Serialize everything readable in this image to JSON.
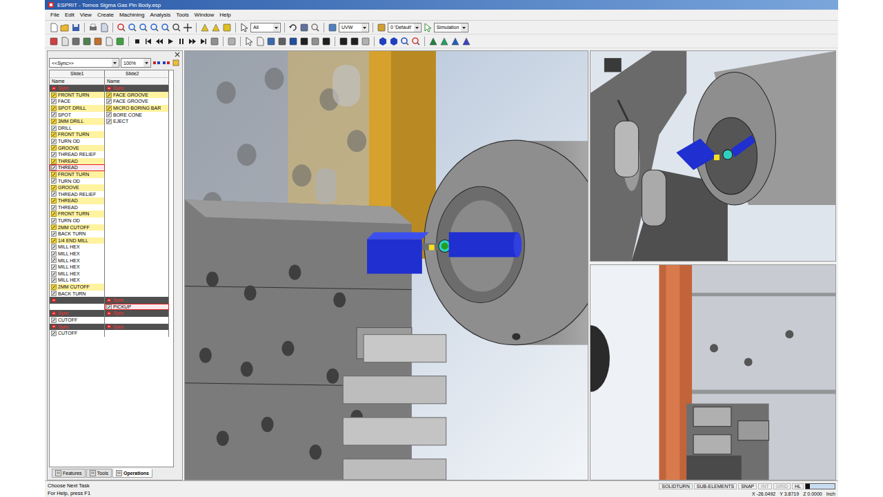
{
  "window": {
    "title": "ESPRIT - Tornos Sigma Gas Pin Body.esp"
  },
  "menu": [
    "File",
    "Edit",
    "View",
    "Create",
    "Machining",
    "Analysis",
    "Tools",
    "Window",
    "Help"
  ],
  "toolbar": {
    "combos": [
      "All",
      "UVW",
      "0 'Default'",
      "Simulation"
    ]
  },
  "operations_panel": {
    "sync_filter": "<<Sync>>",
    "zoom": "100%",
    "columns": [
      "Slide1",
      "Slide2"
    ],
    "subheaders": [
      "Name",
      "Name"
    ],
    "rows": [
      {
        "cells": [
          {
            "text": "Sync",
            "kind": "sync",
            "highlighted": false,
            "selected": false
          },
          {
            "text": "Sync",
            "kind": "sync",
            "highlighted": false,
            "selected": false
          }
        ]
      },
      {
        "cells": [
          {
            "text": "FRONT TURN",
            "kind": "op",
            "highlighted": true,
            "selected": false
          },
          {
            "text": "FACE GROOVE",
            "kind": "op",
            "highlighted": true,
            "selected": false
          }
        ]
      },
      {
        "cells": [
          {
            "text": "FACE",
            "kind": "op",
            "highlighted": false,
            "selected": false
          },
          {
            "text": "FACE GROOVE",
            "kind": "op",
            "highlighted": false,
            "selected": false
          }
        ]
      },
      {
        "cells": [
          {
            "text": "SPOT DRILL",
            "kind": "op",
            "highlighted": true,
            "selected": false
          },
          {
            "text": "MICRO BORING BAR",
            "kind": "op",
            "highlighted": true,
            "selected": false
          }
        ]
      },
      {
        "cells": [
          {
            "text": "SPOT",
            "kind": "op",
            "highlighted": false,
            "selected": false
          },
          {
            "text": "BORE CONE",
            "kind": "op",
            "highlighted": false,
            "selected": false
          }
        ]
      },
      {
        "cells": [
          {
            "text": "3MM DRILL",
            "kind": "op",
            "highlighted": true,
            "selected": false
          },
          {
            "text": "EJECT",
            "kind": "op",
            "highlighted": false,
            "selected": false
          }
        ]
      },
      {
        "cells": [
          {
            "text": "DRILL",
            "kind": "op",
            "highlighted": false,
            "selected": false
          },
          {
            "text": "",
            "kind": "empty",
            "highlighted": false,
            "selected": false
          }
        ]
      },
      {
        "cells": [
          {
            "text": "FRONT TURN",
            "kind": "op",
            "highlighted": true,
            "selected": false
          },
          {
            "text": "",
            "kind": "empty",
            "highlighted": false,
            "selected": false
          }
        ]
      },
      {
        "cells": [
          {
            "text": "TURN OD",
            "kind": "op",
            "highlighted": false,
            "selected": false
          },
          {
            "text": "",
            "kind": "empty",
            "highlighted": false,
            "selected": false
          }
        ]
      },
      {
        "cells": [
          {
            "text": "GROOVE",
            "kind": "op",
            "highlighted": true,
            "selected": false
          },
          {
            "text": "",
            "kind": "empty",
            "highlighted": false,
            "selected": false
          }
        ]
      },
      {
        "cells": [
          {
            "text": "THREAD RELIEF",
            "kind": "op",
            "highlighted": false,
            "selected": false
          },
          {
            "text": "",
            "kind": "empty",
            "highlighted": false,
            "selected": false
          }
        ]
      },
      {
        "cells": [
          {
            "text": "THREAD",
            "kind": "op",
            "highlighted": true,
            "selected": false
          },
          {
            "text": "",
            "kind": "empty",
            "highlighted": false,
            "selected": false
          }
        ]
      },
      {
        "cells": [
          {
            "text": "THREAD",
            "kind": "op",
            "highlighted": false,
            "selected": true
          },
          {
            "text": "",
            "kind": "empty",
            "highlighted": false,
            "selected": false
          }
        ]
      },
      {
        "cells": [
          {
            "text": "FRONT TURN",
            "kind": "op",
            "highlighted": true,
            "selected": false
          },
          {
            "text": "",
            "kind": "empty",
            "highlighted": false,
            "selected": false
          }
        ]
      },
      {
        "cells": [
          {
            "text": "TURN OD",
            "kind": "op",
            "highlighted": false,
            "selected": false
          },
          {
            "text": "",
            "kind": "empty",
            "highlighted": false,
            "selected": false
          }
        ]
      },
      {
        "cells": [
          {
            "text": "GROOVE",
            "kind": "op",
            "highlighted": true,
            "selected": false
          },
          {
            "text": "",
            "kind": "empty",
            "highlighted": false,
            "selected": false
          }
        ]
      },
      {
        "cells": [
          {
            "text": "THREAD RELIEF",
            "kind": "op",
            "highlighted": false,
            "selected": false
          },
          {
            "text": "",
            "kind": "empty",
            "highlighted": false,
            "selected": false
          }
        ]
      },
      {
        "cells": [
          {
            "text": "THREAD",
            "kind": "op",
            "highlighted": true,
            "selected": false
          },
          {
            "text": "",
            "kind": "empty",
            "highlighted": false,
            "selected": false
          }
        ]
      },
      {
        "cells": [
          {
            "text": "THREAD",
            "kind": "op",
            "highlighted": false,
            "selected": false
          },
          {
            "text": "",
            "kind": "empty",
            "highlighted": false,
            "selected": false
          }
        ]
      },
      {
        "cells": [
          {
            "text": "FRONT TURN",
            "kind": "op",
            "highlighted": true,
            "selected": false
          },
          {
            "text": "",
            "kind": "empty",
            "highlighted": false,
            "selected": false
          }
        ]
      },
      {
        "cells": [
          {
            "text": "TURN OD",
            "kind": "op",
            "highlighted": false,
            "selected": false
          },
          {
            "text": "",
            "kind": "empty",
            "highlighted": false,
            "selected": false
          }
        ]
      },
      {
        "cells": [
          {
            "text": "2MM CUTOFF",
            "kind": "op",
            "highlighted": true,
            "selected": false
          },
          {
            "text": "",
            "kind": "empty",
            "highlighted": false,
            "selected": false
          }
        ]
      },
      {
        "cells": [
          {
            "text": "BACK TURN",
            "kind": "op",
            "highlighted": false,
            "selected": false
          },
          {
            "text": "",
            "kind": "empty",
            "highlighted": false,
            "selected": false
          }
        ]
      },
      {
        "cells": [
          {
            "text": "1/4 END MILL",
            "kind": "op",
            "highlighted": true,
            "selected": false
          },
          {
            "text": "",
            "kind": "empty",
            "highlighted": false,
            "selected": false
          }
        ]
      },
      {
        "cells": [
          {
            "text": "MILL HEX",
            "kind": "op",
            "highlighted": false,
            "selected": false
          },
          {
            "text": "",
            "kind": "empty",
            "highlighted": false,
            "selected": false
          }
        ]
      },
      {
        "cells": [
          {
            "text": "MILL HEX",
            "kind": "op",
            "highlighted": false,
            "selected": false
          },
          {
            "text": "",
            "kind": "empty",
            "highlighted": false,
            "selected": false
          }
        ]
      },
      {
        "cells": [
          {
            "text": "MILL HEX",
            "kind": "op",
            "highlighted": false,
            "selected": false
          },
          {
            "text": "",
            "kind": "empty",
            "highlighted": false,
            "selected": false
          }
        ]
      },
      {
        "cells": [
          {
            "text": "MILL HEX",
            "kind": "op",
            "highlighted": false,
            "selected": false
          },
          {
            "text": "",
            "kind": "empty",
            "highlighted": false,
            "selected": false
          }
        ]
      },
      {
        "cells": [
          {
            "text": "MILL HEX",
            "kind": "op",
            "highlighted": false,
            "selected": false
          },
          {
            "text": "",
            "kind": "empty",
            "highlighted": false,
            "selected": false
          }
        ]
      },
      {
        "cells": [
          {
            "text": "MILL HEX",
            "kind": "op",
            "highlighted": false,
            "selected": false
          },
          {
            "text": "",
            "kind": "empty",
            "highlighted": false,
            "selected": false
          }
        ]
      },
      {
        "cells": [
          {
            "text": "2MM CUTOFF",
            "kind": "op",
            "highlighted": true,
            "selected": false
          },
          {
            "text": "",
            "kind": "empty",
            "highlighted": false,
            "selected": false
          }
        ]
      },
      {
        "cells": [
          {
            "text": "BACK TURN",
            "kind": "op",
            "highlighted": false,
            "selected": false
          },
          {
            "text": "",
            "kind": "empty",
            "highlighted": false,
            "selected": false
          }
        ]
      },
      {
        "cells": [
          {
            "text": "",
            "kind": "sync",
            "highlighted": false,
            "selected": false
          },
          {
            "text": "Sync",
            "kind": "sync",
            "highlighted": false,
            "selected": false
          }
        ]
      },
      {
        "cells": [
          {
            "text": "",
            "kind": "empty",
            "highlighted": false,
            "selected": false
          },
          {
            "text": "PICKUP",
            "kind": "op",
            "highlighted": false,
            "selected": true
          }
        ]
      },
      {
        "cells": [
          {
            "text": "Sync",
            "kind": "sync",
            "highlighted": false,
            "selected": false
          },
          {
            "text": "Sync",
            "kind": "sync",
            "highlighted": false,
            "selected": false
          }
        ]
      },
      {
        "cells": [
          {
            "text": "CUTOFF",
            "kind": "op",
            "highlighted": false,
            "selected": false
          },
          {
            "text": "",
            "kind": "empty",
            "highlighted": false,
            "selected": false
          }
        ]
      },
      {
        "cells": [
          {
            "text": "Sync",
            "kind": "sync",
            "highlighted": false,
            "selected": false
          },
          {
            "text": "Sync",
            "kind": "sync",
            "highlighted": false,
            "selected": false
          }
        ]
      },
      {
        "cells": [
          {
            "text": "CUTOFF",
            "kind": "op",
            "highlighted": false,
            "selected": false
          },
          {
            "text": "",
            "kind": "empty",
            "highlighted": false,
            "selected": false
          }
        ]
      }
    ]
  },
  "panel_tabs": [
    {
      "label": "Features",
      "selected": false
    },
    {
      "label": "Tools",
      "selected": false
    },
    {
      "label": "Operations",
      "selected": true
    }
  ],
  "status_bar": {
    "prompt": "Choose Next Task",
    "help": "For Help, press F1",
    "modes": [
      {
        "label": "SOLIDTURN",
        "on": true
      },
      {
        "label": "SUB-ELEMENTS",
        "on": true
      },
      {
        "label": "SNAP",
        "on": true
      },
      {
        "label": "INT",
        "on": false
      },
      {
        "label": "GRID",
        "on": false
      },
      {
        "label": "HL",
        "on": true
      }
    ],
    "progress": {
      "level": 0.15
    },
    "coordinates": [
      "X -26.0492",
      "Y 3.8719",
      "Z 0.0000"
    ],
    "units": "Inch"
  }
}
